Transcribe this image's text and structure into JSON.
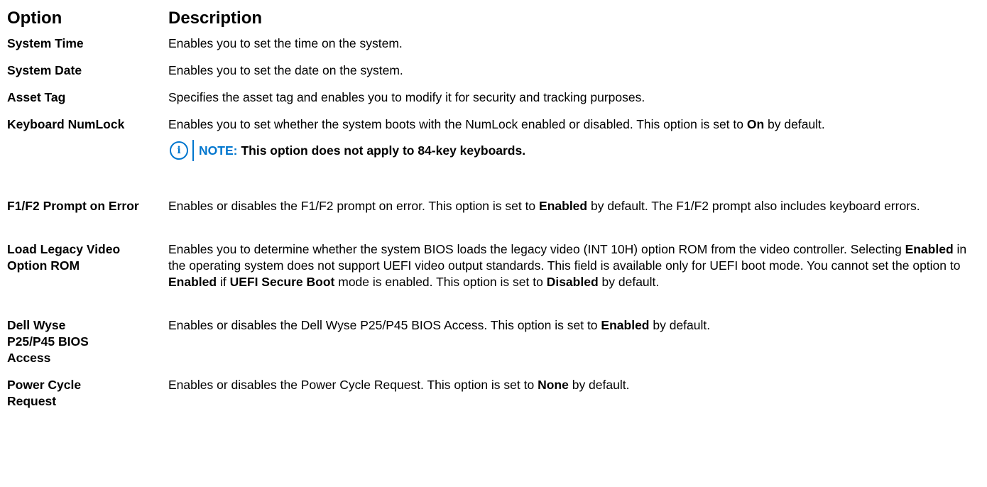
{
  "header": {
    "option": "Option",
    "description": "Description"
  },
  "rows": [
    {
      "option": "System Time",
      "description": "Enables you to set the time on the system."
    },
    {
      "option": "System Date",
      "description": "Enables you to set the date on the system."
    },
    {
      "option": "Asset Tag",
      "description": "Specifies the asset tag and enables you to modify it for security and tracking purposes."
    },
    {
      "option": "Keyboard NumLock",
      "desc_parts": [
        "Enables you to set whether the system boots with the NumLock enabled or disabled. This option is set to ",
        "On",
        " by default."
      ],
      "note_label": "NOTE:",
      "note_text": "This option does not apply to 84-key keyboards."
    },
    {
      "option": "F1/F2 Prompt on Error",
      "desc_parts": [
        "Enables or disables the F1/F2 prompt on error. This option is set to ",
        "Enabled",
        " by default. The F1/F2 prompt also includes keyboard errors."
      ]
    },
    {
      "option": "Load Legacy Video Option ROM",
      "desc_parts": [
        "Enables you to determine whether the system BIOS loads the legacy video (INT 10H) option ROM from the video controller. Selecting ",
        "Enabled",
        " in the operating system does not support UEFI video output standards. This field is available only for UEFI boot mode. You cannot set the option to ",
        "Enabled",
        " if ",
        "UEFI Secure Boot",
        " mode is enabled. This option is set to ",
        "Disabled",
        " by default."
      ]
    },
    {
      "option": "Dell Wyse P25/P45 BIOS Access",
      "desc_parts": [
        "Enables or disables the Dell Wyse P25/P45 BIOS Access. This option is set to ",
        "Enabled",
        " by default."
      ]
    },
    {
      "option": "Power Cycle Request",
      "desc_parts": [
        "Enables or disables the Power Cycle Request. This option is set to ",
        "None",
        " by default."
      ]
    }
  ],
  "icons": {
    "note": "info-icon"
  },
  "colors": {
    "note_accent": "#0076ce"
  }
}
